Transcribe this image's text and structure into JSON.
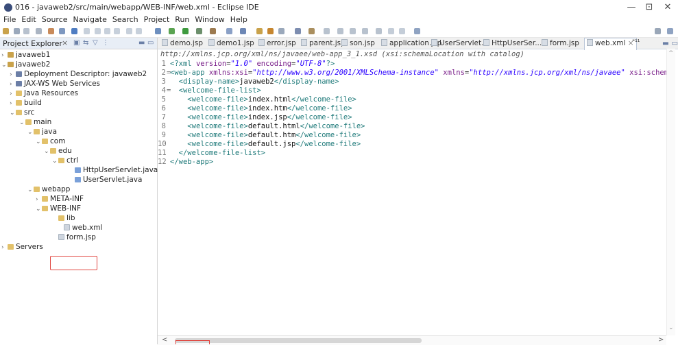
{
  "window": {
    "title": "016 - javaweb2/src/main/webapp/WEB-INF/web.xml - Eclipse IDE",
    "minimize": "—",
    "maximize": "⊡",
    "close": "✕"
  },
  "menu": [
    "File",
    "Edit",
    "Source",
    "Navigate",
    "Search",
    "Project",
    "Run",
    "Window",
    "Help"
  ],
  "left_panel": {
    "tab_label": "Project Explorer",
    "tab_close": "×",
    "tree": [
      {
        "label": "javaweb1",
        "arrow": "›",
        "icon": "project"
      },
      {
        "label": "javaweb2",
        "arrow": "⌄",
        "icon": "project"
      },
      {
        "label": "Deployment Descriptor: javaweb2",
        "arrow": "›",
        "icon": "dd"
      },
      {
        "label": "JAX-WS Web Services",
        "arrow": "›",
        "icon": "dd"
      },
      {
        "label": "Java Resources",
        "arrow": "›",
        "icon": "folder"
      },
      {
        "label": "build",
        "arrow": "›",
        "icon": "folder"
      },
      {
        "label": "src",
        "arrow": "⌄",
        "icon": "folder"
      },
      {
        "label": "main",
        "arrow": "⌄",
        "icon": "folder"
      },
      {
        "label": "java",
        "arrow": "⌄",
        "icon": "folder"
      },
      {
        "label": "com",
        "arrow": "⌄",
        "icon": "folder"
      },
      {
        "label": "edu",
        "arrow": "⌄",
        "icon": "folder"
      },
      {
        "label": "ctrl",
        "arrow": "⌄",
        "icon": "folder"
      },
      {
        "label": "HttpUserServlet.java",
        "arrow": "",
        "icon": "java"
      },
      {
        "label": "UserServlet.java",
        "arrow": "",
        "icon": "java"
      },
      {
        "label": "webapp",
        "arrow": "⌄",
        "icon": "folder"
      },
      {
        "label": "META-INF",
        "arrow": "›",
        "icon": "folder"
      },
      {
        "label": "WEB-INF",
        "arrow": "⌄",
        "icon": "folder"
      },
      {
        "label": "lib",
        "arrow": "",
        "icon": "folder"
      },
      {
        "label": "web.xml",
        "arrow": "",
        "icon": "file"
      },
      {
        "label": "form.jsp",
        "arrow": "",
        "icon": "file"
      },
      {
        "label": "Servers",
        "arrow": "›",
        "icon": "folder"
      }
    ]
  },
  "editor": {
    "tabs": [
      "demo.jsp",
      "demo1.jsp",
      "error.jsp",
      "parent.jsp",
      "son.jsp",
      "application.jsp",
      "UserServlet...",
      "HttpUserSer...",
      "form.jsp",
      "web.xml"
    ],
    "active_tab_close": "×",
    "overflow": "\"¹¹",
    "hover_line": "http://xmlns.jcp.org/xml/ns/javaee/web-app_3_1.xsd (xsi:schemaLocation with catalog)",
    "line_numbers": [
      "1",
      "2",
      "3",
      "4",
      "5",
      "6",
      "7",
      "8",
      "9",
      "10",
      "11",
      "12"
    ],
    "fold_markers": {
      "2": "=",
      "4": "="
    },
    "line1": {
      "open": "<?xml",
      "a1": "version",
      "v1": "\"1.0\"",
      "a2": "encoding",
      "v2": "\"UTF-8\"",
      "close": "?>"
    },
    "line2": {
      "open": "<web-app",
      "a1": "xmlns:xsi",
      "v1": "\"http://www.w3.org/2001/XMLSchema-instance\"",
      "a2": "xmlns",
      "v2": "\"http://xmlns.jcp.org/xml/ns/javaee\"",
      "a3": "xsi:schemaLo"
    },
    "display_name": "javaweb2",
    "welcome_files": [
      "index.html",
      "index.htm",
      "index.jsp",
      "default.html",
      "default.htm",
      "default.jsp"
    ],
    "tags": {
      "display_open": "<display-name>",
      "display_close": "</display-name>",
      "wfl_open": "<welcome-file-list>",
      "wfl_close": "</welcome-file-list>",
      "wf_open": "<welcome-file>",
      "wf_close": "</welcome-file>",
      "webapp_close": "</web-app>"
    }
  },
  "colors": {
    "tag": "#1f7a7a",
    "attr": "#7a1f8a",
    "string": "#2a00ff",
    "highlight": "#e0443e"
  }
}
